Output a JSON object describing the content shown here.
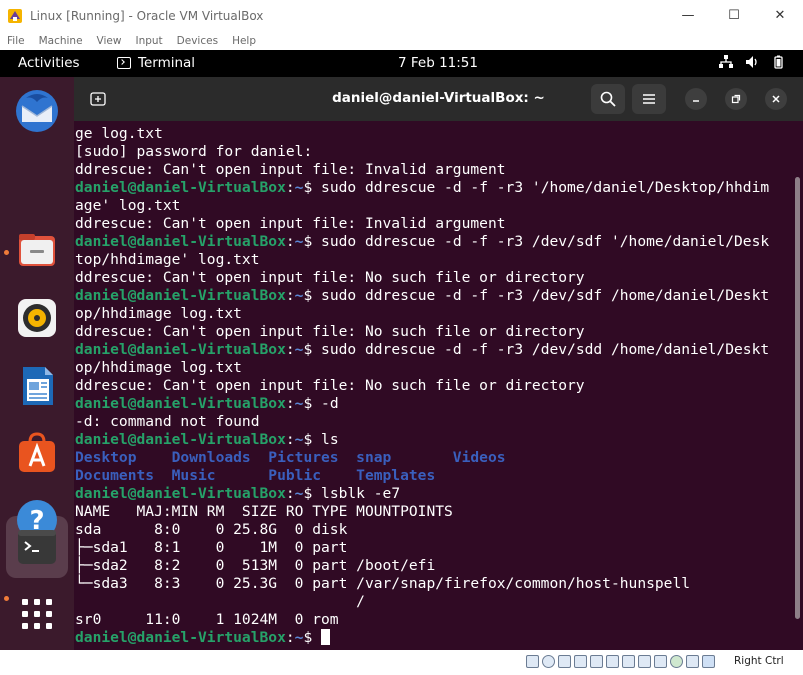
{
  "host": {
    "title": "Linux [Running] - Oracle VM VirtualBox",
    "menu": [
      "File",
      "Machine",
      "View",
      "Input",
      "Devices",
      "Help"
    ],
    "controls": {
      "minimize": "—",
      "maximize": "☐",
      "close": "✕"
    },
    "right_ctrl": "Right Ctrl"
  },
  "topbar": {
    "activities": "Activities",
    "app_name": "Terminal",
    "clock": "7 Feb  11:51"
  },
  "terminal": {
    "title": "daniel@daniel-VirtualBox: ~",
    "prompt_user": "daniel@daniel-VirtualBox",
    "prompt_path": "~",
    "lines": [
      {
        "text": "ge log.txt"
      },
      {
        "text": "[sudo] password for daniel:"
      },
      {
        "text": "ddrescue: Can't open input file: Invalid argument"
      },
      {
        "prompt": true,
        "text": "$ sudo ddrescue -d -f -r3 '/home/daniel/Desktop/hhdim"
      },
      {
        "text": "age' log.txt"
      },
      {
        "text": "ddrescue: Can't open input file: Invalid argument"
      },
      {
        "prompt": true,
        "text": "$ sudo ddrescue -d -f -r3 /dev/sdf '/home/daniel/Desk"
      },
      {
        "text": "top/hhdimage' log.txt"
      },
      {
        "text": "ddrescue: Can't open input file: No such file or directory"
      },
      {
        "prompt": true,
        "text": "$ sudo ddrescue -d -f -r3 /dev/sdf /home/daniel/Deskt"
      },
      {
        "text": "op/hhdimage log.txt"
      },
      {
        "text": "ddrescue: Can't open input file: No such file or directory"
      },
      {
        "prompt": true,
        "text": "$ sudo ddrescue -d -f -r3 /dev/sdd /home/daniel/Deskt"
      },
      {
        "text": "op/hhdimage log.txt"
      },
      {
        "text": "ddrescue: Can't open input file: No such file or directory"
      },
      {
        "prompt": true,
        "text": "$ -d"
      },
      {
        "text": "-d: command not found"
      },
      {
        "prompt": true,
        "text": "$ ls"
      },
      {
        "dirs": true,
        "text": "Desktop    Downloads  Pictures  snap       Videos"
      },
      {
        "dirs": true,
        "text": "Documents  Music      Public    Templates"
      },
      {
        "prompt": true,
        "text": "$ lsblk -e7"
      },
      {
        "text": "NAME   MAJ:MIN RM  SIZE RO TYPE MOUNTPOINTS"
      },
      {
        "text": "sda      8:0    0 25.8G  0 disk"
      },
      {
        "text": "├─sda1   8:1    0    1M  0 part"
      },
      {
        "text": "├─sda2   8:2    0  513M  0 part /boot/efi"
      },
      {
        "text": "└─sda3   8:3    0 25.3G  0 part /var/snap/firefox/common/host-hunspell"
      },
      {
        "text": "                                /"
      },
      {
        "text": "sr0     11:0    1 1024M  0 rom"
      },
      {
        "prompt": true,
        "cursor": true,
        "text": "$ "
      }
    ]
  },
  "dock": [
    {
      "name": "thunderbird",
      "running": false
    },
    {
      "name": "files",
      "running": true
    },
    {
      "name": "rhythmbox",
      "running": false
    },
    {
      "name": "libreoffice-writer",
      "running": false
    },
    {
      "name": "app-center",
      "running": false
    },
    {
      "name": "help",
      "running": false
    },
    {
      "name": "terminal",
      "running": true
    },
    {
      "name": "show-apps",
      "running": false
    }
  ],
  "colors": {
    "terminal_bg": "#300a24",
    "prompt_user": "#26a269",
    "prompt_path": "#5b87d6",
    "directory": "#3a5fbd",
    "header_bg": "#2b2b2b",
    "dock_bg": "#3b1a2c"
  }
}
